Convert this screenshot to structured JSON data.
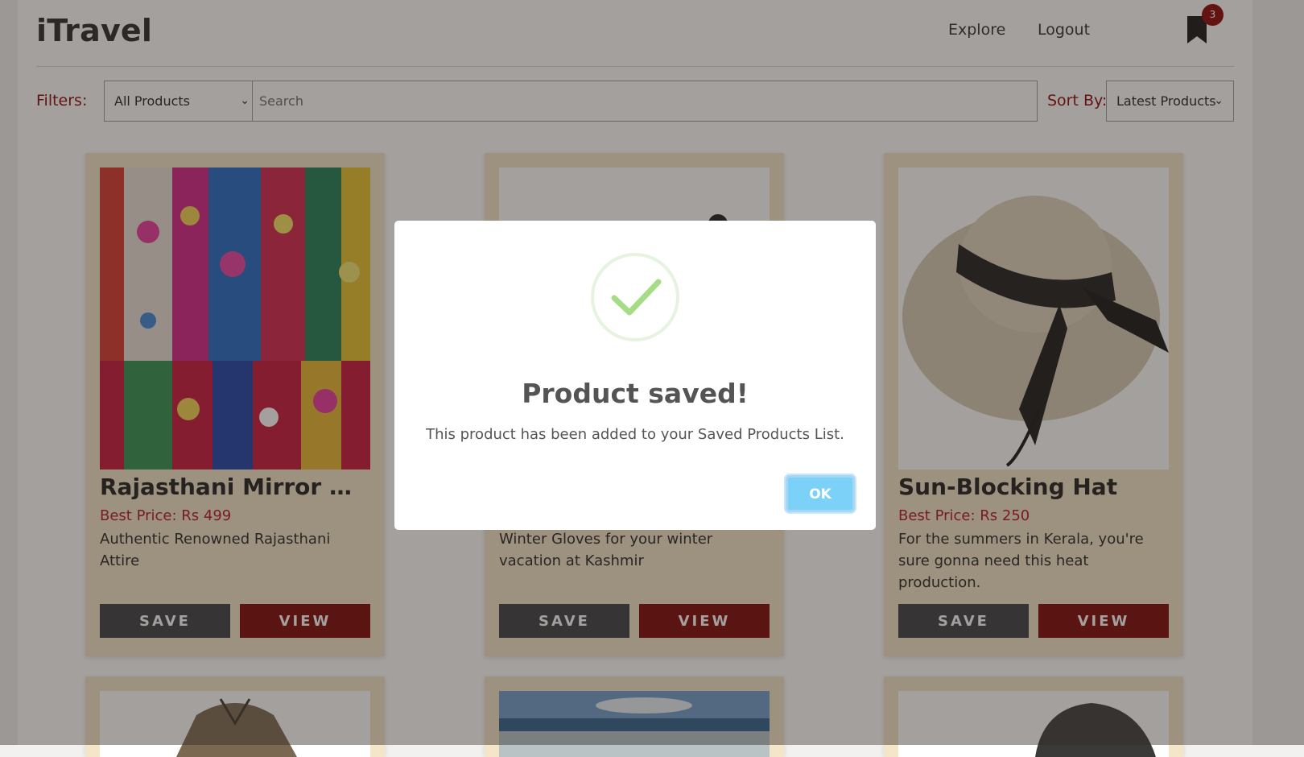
{
  "header": {
    "brand": "iTravel",
    "nav": [
      {
        "label": "Explore"
      },
      {
        "label": "Logout"
      }
    ],
    "saved_count": "3"
  },
  "filters": {
    "filter_label": "Filters:",
    "category_value": "All Products",
    "search_placeholder": "Search",
    "sort_label": "Sort By:",
    "sort_value": "Latest Products"
  },
  "products": [
    {
      "title": "Rajasthani Mirror Wo...",
      "price": "Best Price: Rs 499",
      "description": "Authentic Renowned Rajasthani Attire",
      "save_label": "SAVE",
      "view_label": "VIEW"
    },
    {
      "title": "",
      "price": "",
      "description": "Winter Gloves for your winter vacation at Kashmir",
      "save_label": "SAVE",
      "view_label": "VIEW"
    },
    {
      "title": "Sun-Blocking Hat",
      "price": "Best Price: Rs 250",
      "description": "For the summers in Kerala, you're sure gonna need this heat production.",
      "save_label": "SAVE",
      "view_label": "VIEW"
    }
  ],
  "modal": {
    "title": "Product saved!",
    "message": "This product has been added to your Saved Products List.",
    "ok_label": "OK",
    "icon": "check-icon"
  },
  "colors": {
    "brand_red": "#8b0000",
    "card_bg": "#f4e6c8",
    "save_btn": "#3a3b3e",
    "view_btn": "#7a0000",
    "ok_btn": "#7cd1f9",
    "success_green": "#a5dc86"
  }
}
